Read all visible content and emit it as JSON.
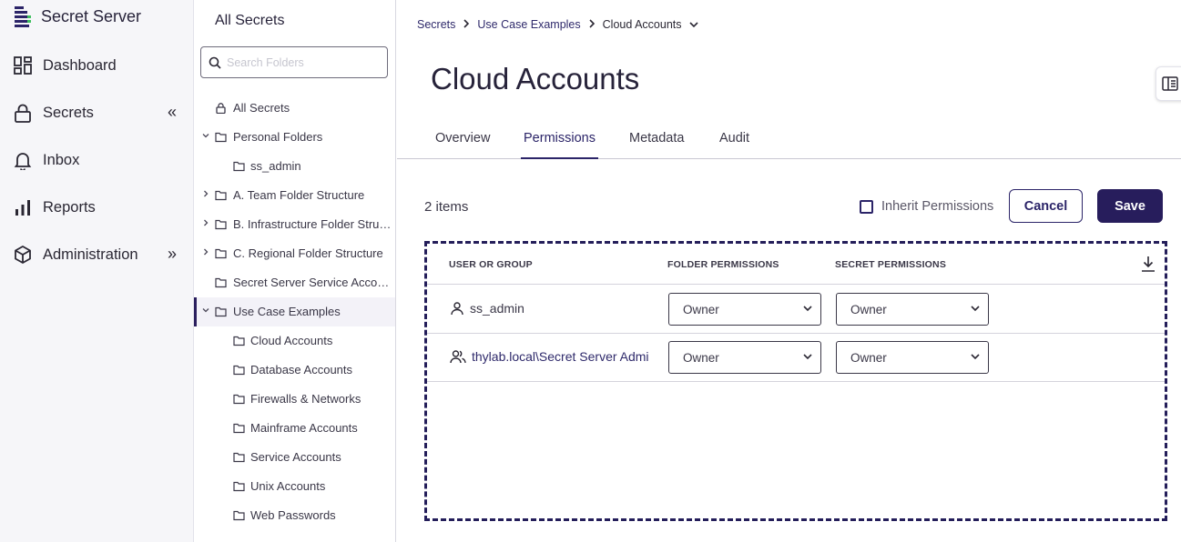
{
  "app": {
    "name": "Secret Server"
  },
  "nav": {
    "items": [
      {
        "label": "Dashboard",
        "icon": "dashboard-icon"
      },
      {
        "label": "Secrets",
        "icon": "lock-icon",
        "collapse": "«"
      },
      {
        "label": "Inbox",
        "icon": "bell-icon"
      },
      {
        "label": "Reports",
        "icon": "bar-chart-icon"
      },
      {
        "label": "Administration",
        "icon": "cube-icon",
        "expand": "»"
      }
    ]
  },
  "folders": {
    "title": "All Secrets",
    "search_placeholder": "Search Folders",
    "tree": [
      {
        "label": "All Secrets",
        "icon": "lock-icon"
      },
      {
        "label": "Personal Folders",
        "icon": "folder-icon",
        "chevron": "down"
      },
      {
        "label": "ss_admin",
        "icon": "folder-icon"
      },
      {
        "label": "A. Team Folder Structure",
        "icon": "folder-icon",
        "chevron": "right"
      },
      {
        "label": "B. Infrastructure Folder Structure",
        "icon": "folder-icon",
        "chevron": "right"
      },
      {
        "label": "C. Regional Folder Structure",
        "icon": "folder-icon",
        "chevron": "right"
      },
      {
        "label": "Secret Server Service Accounts",
        "icon": "folder-icon"
      },
      {
        "label": "Use Case Examples",
        "icon": "folder-icon",
        "chevron": "down",
        "selected": true
      },
      {
        "label": "Cloud Accounts",
        "icon": "folder-icon"
      },
      {
        "label": "Database Accounts",
        "icon": "folder-icon"
      },
      {
        "label": "Firewalls & Networks",
        "icon": "folder-icon"
      },
      {
        "label": "Mainframe Accounts",
        "icon": "folder-icon"
      },
      {
        "label": "Service Accounts",
        "icon": "folder-icon"
      },
      {
        "label": "Unix Accounts",
        "icon": "folder-icon"
      },
      {
        "label": "Web Passwords",
        "icon": "folder-icon"
      }
    ]
  },
  "breadcrumb": {
    "items": [
      "Secrets",
      "Use Case Examples"
    ],
    "current": "Cloud Accounts"
  },
  "page": {
    "title": "Cloud Accounts"
  },
  "tabs": [
    {
      "label": "Overview"
    },
    {
      "label": "Permissions",
      "active": true
    },
    {
      "label": "Metadata"
    },
    {
      "label": "Audit"
    }
  ],
  "toolbar": {
    "item_count": "2 items",
    "inherit_label": "Inherit Permissions",
    "inherit_checked": false,
    "cancel_label": "Cancel",
    "save_label": "Save"
  },
  "table": {
    "headers": {
      "user": "USER OR GROUP",
      "folder": "FOLDER PERMISSIONS",
      "secret": "SECRET PERMISSIONS"
    },
    "rows": [
      {
        "user": "ss_admin",
        "user_icon": "user-icon",
        "folder": "Owner",
        "secret": "Owner"
      },
      {
        "user": "thylab.local\\Secret Server Admi",
        "user_icon": "group-icon",
        "folder": "Owner",
        "secret": "Owner"
      }
    ]
  },
  "colors": {
    "primary": "#271d5c",
    "link": "#2f2a6b",
    "nav_bg": "#f6f6f9"
  }
}
